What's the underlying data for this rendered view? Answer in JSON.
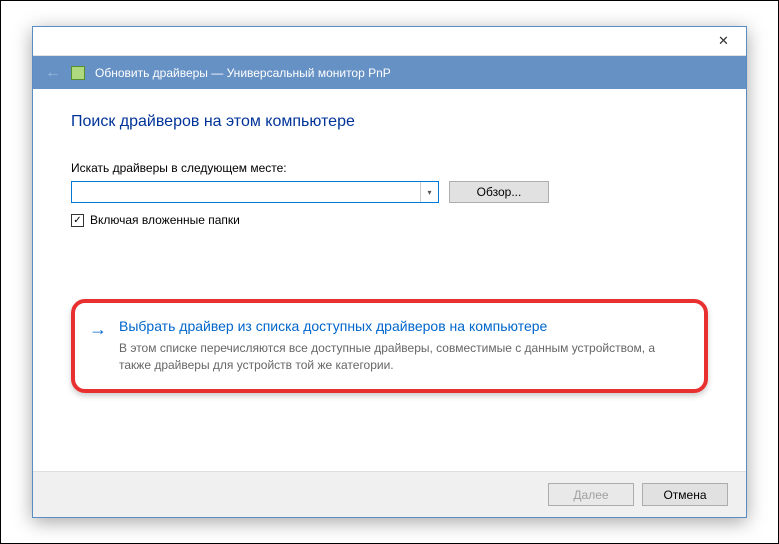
{
  "header": {
    "title": "Обновить драйверы — Универсальный монитор PnP"
  },
  "page": {
    "heading": "Поиск драйверов на этом компьютере",
    "search_label": "Искать драйверы в следующем месте:",
    "path_value": "",
    "browse_label": "Обзор...",
    "include_subfolders_label": "Включая вложенные папки"
  },
  "option": {
    "title": "Выбрать драйвер из списка доступных драйверов на компьютере",
    "description": "В этом списке перечисляются все доступные драйверы, совместимые с данным устройством, а также драйверы для устройств той же категории."
  },
  "footer": {
    "next_label": "Далее",
    "cancel_label": "Отмена"
  }
}
